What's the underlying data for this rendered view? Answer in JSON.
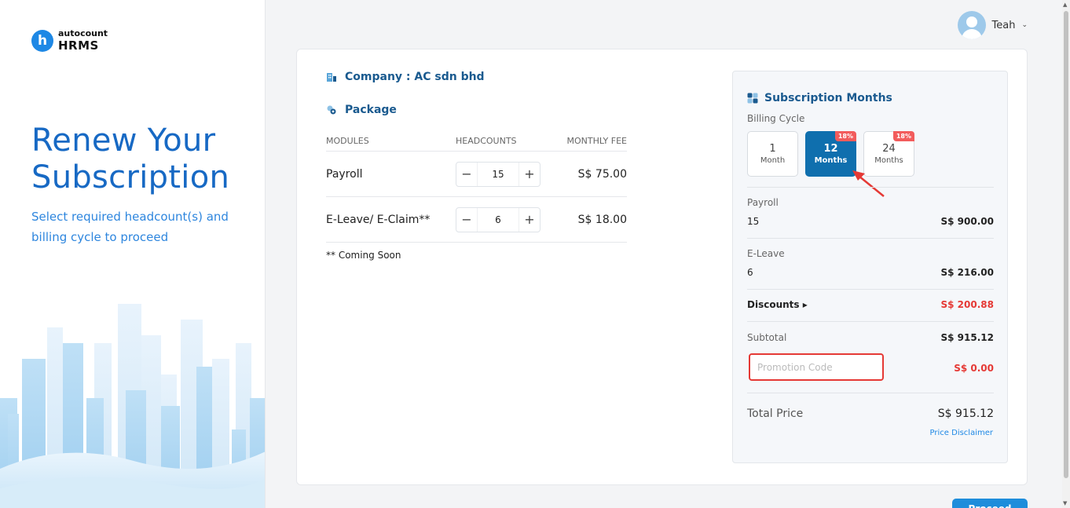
{
  "brand": {
    "logo_letter": "h",
    "logo_top": "autocount",
    "logo_bottom": "HRMS"
  },
  "hero": {
    "title_line1": "Renew Your",
    "title_line2": "Subscription",
    "subtitle": "Select required headcount(s) and billing cycle to proceed"
  },
  "user": {
    "name": "Teah",
    "chevron": "⌄"
  },
  "company": {
    "label": "Company : AC sdn bhd"
  },
  "package": {
    "label": "Package",
    "columns": [
      "MODULES",
      "HEADCOUNTS",
      "MONTHLY FEE"
    ],
    "rows": [
      {
        "module": "Payroll",
        "headcount": "15",
        "fee": "S$ 75.00"
      },
      {
        "module": "E-Leave/ E-Claim**",
        "headcount": "6",
        "fee": "S$ 18.00"
      }
    ],
    "minus": "−",
    "plus": "+",
    "note": "** Coming Soon"
  },
  "subscription": {
    "title": "Subscription Months",
    "billing_label": "Billing Cycle",
    "cycles": [
      {
        "num": "1",
        "unit": "Month",
        "badge": ""
      },
      {
        "num": "12",
        "unit": "Months",
        "badge": "18%"
      },
      {
        "num": "24",
        "unit": "Months",
        "badge": "18%"
      }
    ],
    "selected_index": 1,
    "payroll_label": "Payroll",
    "payroll_count": "15",
    "payroll_total": "S$ 900.00",
    "eleave_label": "E-Leave",
    "eleave_count": "6",
    "eleave_total": "S$ 216.00",
    "discount_label": "Discounts ▸",
    "discount_value": "S$ 200.88",
    "subtotal_label": "Subtotal",
    "subtotal_value": "S$ 915.12",
    "promo_placeholder": "Promotion Code",
    "promo_value": "S$ 0.00",
    "total_label": "Total Price",
    "total_value": "S$ 915.12",
    "disclaimer": "Price Disclaimer"
  },
  "proceed_label": "Proceed",
  "colors": {
    "primary": "#0f6fae",
    "accent": "#1e88e5",
    "danger": "#e53935",
    "badge": "#f25c5c"
  }
}
